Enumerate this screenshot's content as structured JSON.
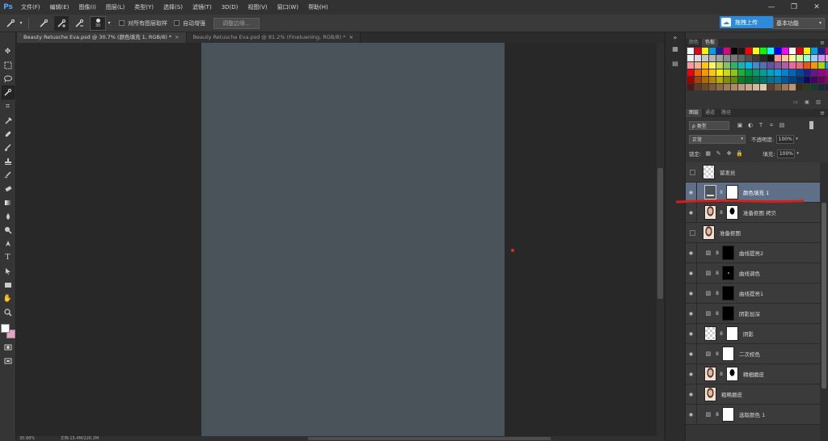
{
  "menu": {
    "logo": "Ps",
    "items": [
      "文件(F)",
      "编辑(E)",
      "图像(I)",
      "图层(L)",
      "类型(Y)",
      "选择(S)",
      "滤镜(T)",
      "3D(D)",
      "视图(V)",
      "窗口(W)",
      "帮助(H)"
    ],
    "win_controls": [
      "—",
      "❐",
      "✕"
    ]
  },
  "options": {
    "brush_size": "30",
    "sample_all_layers": "对所有图层取样",
    "auto_enhance": "自动增强",
    "refine_edge": "调整边缘...",
    "upload": "拖拽上传",
    "workspace": "基本功能"
  },
  "tabs": [
    {
      "label": "Beauty Retusche Eva.psd @ 30.7% (颜色填充 1, RGB/8) *",
      "close": "×"
    },
    {
      "label": "Beauty Retusche Eva.psd @ 81.2% (Finetuening, RGB/8) *",
      "close": "×"
    }
  ],
  "status": {
    "zoom": "30.68%",
    "doc": "文档:15.4M/226.2M"
  },
  "colors": {
    "foreground": "#ffffff",
    "background": "#e8a1c6",
    "canvas": "#4a525a",
    "accent": "#2e8bd9",
    "selection": "#5f6f88"
  },
  "swatch_panel": {
    "tabs": [
      "颜色",
      "色板"
    ],
    "colors": [
      "#ffffff",
      "#e60012",
      "#fff100",
      "#00a0e9",
      "#1d2088",
      "#e4007f",
      "#000000",
      "#231815",
      "#ff0000",
      "#ffff00",
      "#00ff00",
      "#00ffff",
      "#0000ff",
      "#ff00ff",
      "#ffffff",
      "#e60012",
      "#fff100",
      "#00a0e9",
      "#1d2088",
      "#e4007f",
      "#efefef",
      "#dcdcdc",
      "#c8c8c8",
      "#b4b4b4",
      "#a0a0a0",
      "#8c8c8c",
      "#787878",
      "#646464",
      "#505050",
      "#3c3c3c",
      "#282828",
      "#141414",
      "#ff9999",
      "#ffcc99",
      "#ffff99",
      "#ccff99",
      "#99ffcc",
      "#99ccff",
      "#cc99ff",
      "#ff99cc",
      "#f29c9f",
      "#f5b090",
      "#fcc800",
      "#fff45c",
      "#c3d94e",
      "#80c269",
      "#32b16c",
      "#13b5b1",
      "#00b7ee",
      "#448aca",
      "#556fb5",
      "#5f52a0",
      "#8957a1",
      "#ae5da1",
      "#ea68a2",
      "#eb6877",
      "#e95513",
      "#f39800",
      "#a6d608",
      "#00a1d6",
      "#e60012",
      "#eb6100",
      "#f39800",
      "#fcc800",
      "#fff100",
      "#cfdb00",
      "#8fc31f",
      "#22ac38",
      "#009944",
      "#009b6b",
      "#009e96",
      "#00a0c1",
      "#00a0e9",
      "#0086d1",
      "#0068b7",
      "#00479d",
      "#1d2088",
      "#601986",
      "#920783",
      "#be0081",
      "#a40000",
      "#a84200",
      "#ac6a00",
      "#b28500",
      "#b7aa00",
      "#8a8c00",
      "#638c0b",
      "#097c25",
      "#007130",
      "#00734d",
      "#00746b",
      "#007589",
      "#0075a9",
      "#00579c",
      "#004486",
      "#002e73",
      "#100964",
      "#440062",
      "#6a005f",
      "#8f006a",
      "#4a1a1a",
      "#5a3a20",
      "#6b4a2a",
      "#7b5a3a",
      "#8c6a4a",
      "#9c7a5a",
      "#ad8a6a",
      "#bd9a7a",
      "#c8a98a",
      "#d4b89a",
      "#e0c8aa",
      "#5c3d2e",
      "#7d5a44",
      "#9e775a",
      "#bf9470",
      "#3a2a1a",
      "#2a3a1a",
      "#1a3a2a",
      "#1a2a3a",
      "#2a1a3a"
    ]
  },
  "layers_panel": {
    "tabs": [
      "图层",
      "通道",
      "路径"
    ],
    "filter_kind": "ρ 类型",
    "blend_mode": "正常",
    "opacity_label": "不透明度:",
    "opacity": "100%",
    "lock_label": "锁定:",
    "fill_label": "填充:",
    "fill": "100%",
    "layers": [
      {
        "name": "留发丝",
        "visible": false,
        "thumb": "checker"
      },
      {
        "name": "颜色填充 1",
        "visible": true,
        "thumb": "fill",
        "selected": true
      },
      {
        "name": "准备抠图 拷贝",
        "visible": true,
        "thumb": "face",
        "mask": "silhouette"
      },
      {
        "name": "准备抠图",
        "visible": false,
        "thumb": "face"
      },
      {
        "name": "曲线提亮2",
        "visible": true,
        "thumb": "adj",
        "mask": "black"
      },
      {
        "name": "曲线调色",
        "visible": true,
        "thumb": "adj",
        "mask": "black"
      },
      {
        "name": "曲线提亮1",
        "visible": true,
        "thumb": "adj",
        "mask": "black"
      },
      {
        "name": "阴影加深",
        "visible": true,
        "thumb": "adj",
        "mask": "black"
      },
      {
        "name": "阴影",
        "visible": true,
        "thumb": "checker",
        "mask": "white"
      },
      {
        "name": "二次校色",
        "visible": true,
        "thumb": "adj",
        "mask": "white"
      },
      {
        "name": "精细磨皮",
        "visible": true,
        "thumb": "face",
        "mask": "silhouette"
      },
      {
        "name": "粗略磨皮",
        "visible": true,
        "thumb": "face"
      },
      {
        "name": "选取颜色 1",
        "visible": true,
        "thumb": "adj",
        "mask": "white"
      }
    ]
  }
}
